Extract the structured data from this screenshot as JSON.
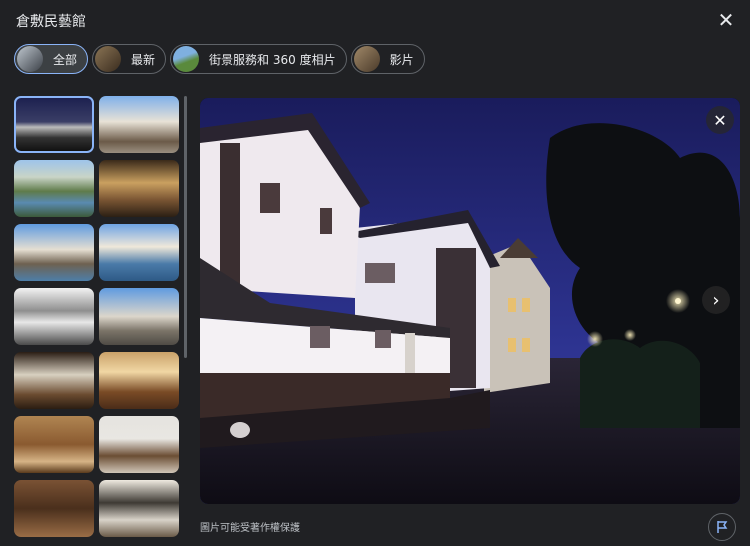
{
  "header": {
    "title": "倉敷民藝館",
    "close_icon": "close-icon"
  },
  "filters": [
    {
      "label": "全部",
      "active": true
    },
    {
      "label": "最新",
      "active": false
    },
    {
      "label": "街景服務和 360 度相片",
      "active": false
    },
    {
      "label": "影片",
      "active": false
    }
  ],
  "viewer": {
    "close_icon": "close-icon",
    "next_icon": "chevron-right-icon",
    "copyright_text": "圖片可能受著作權保護",
    "report_icon": "flag-icon"
  },
  "colors": {
    "background": "#202124",
    "selected_border": "#8ab4f8",
    "chip_border": "#5f6368"
  }
}
